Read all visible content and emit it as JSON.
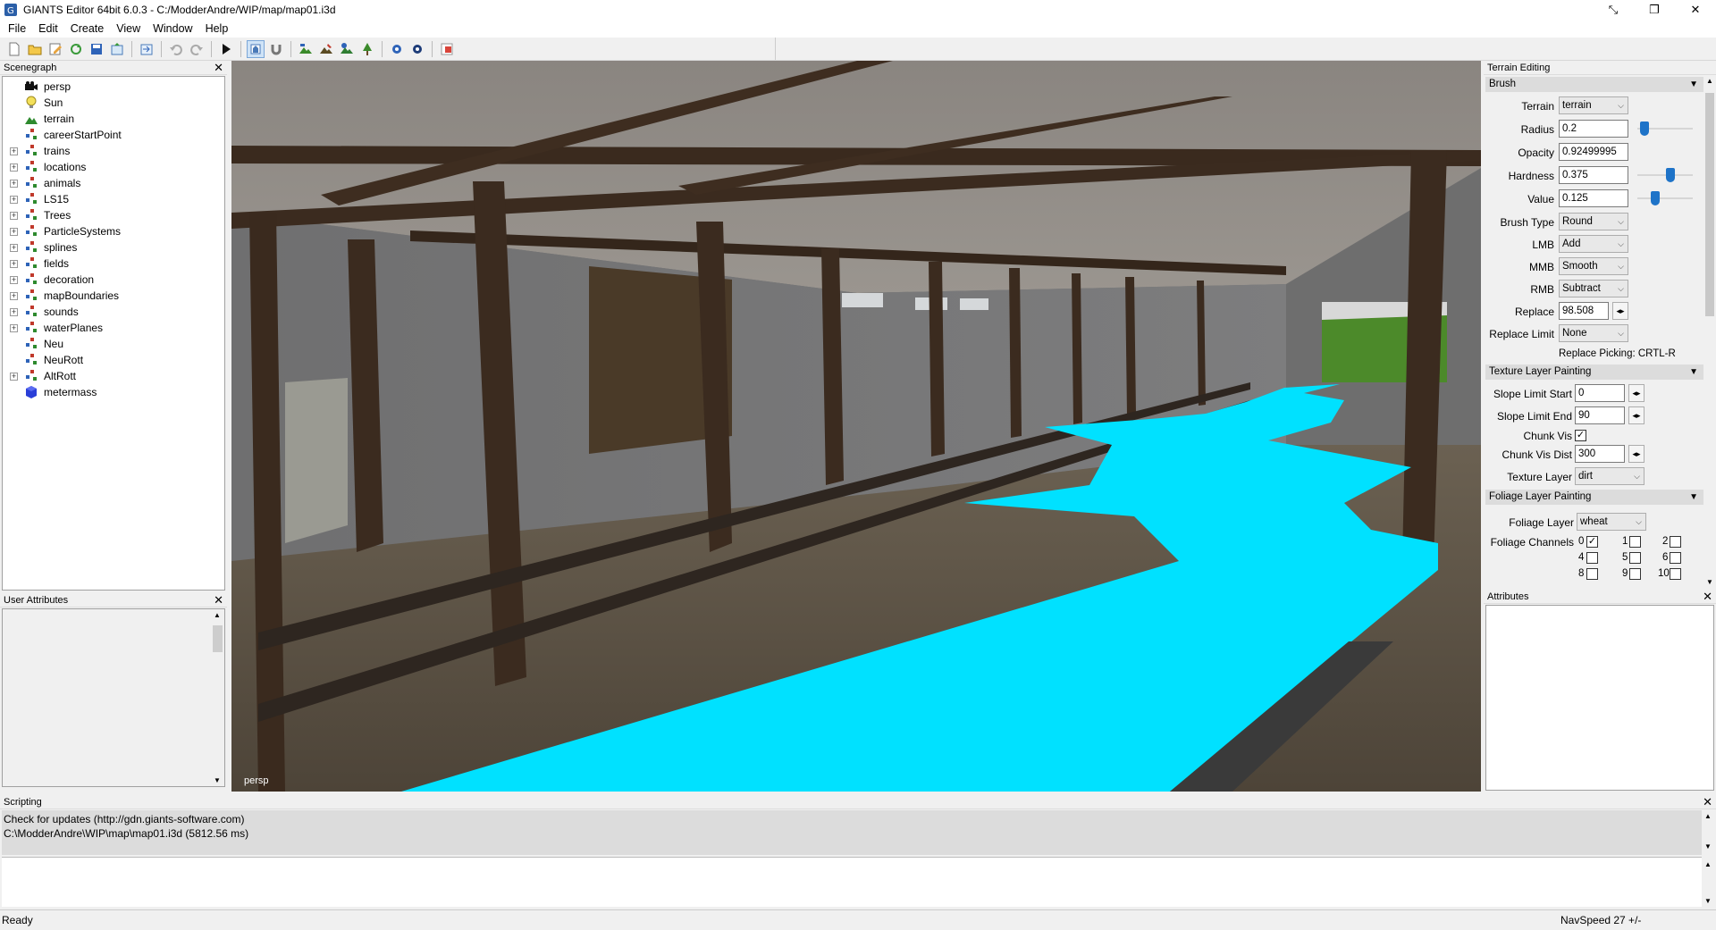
{
  "window": {
    "title": "GIANTS Editor 64bit 6.0.3 - C:/ModderAndre/WIP/map/map01.i3d",
    "restore_glyph": "⤡",
    "maximize_glyph": "❐",
    "close_glyph": "✕"
  },
  "menu": [
    "File",
    "Edit",
    "Create",
    "View",
    "Window",
    "Help"
  ],
  "scenegraph": {
    "title": "Scenegraph",
    "close": "✕",
    "nodes": [
      {
        "label": "persp",
        "icon": "camera-icon",
        "expandable": false
      },
      {
        "label": "Sun",
        "icon": "light-bulb-icon",
        "expandable": false
      },
      {
        "label": "terrain",
        "icon": "terrain-icon",
        "expandable": false
      },
      {
        "label": "careerStartPoint",
        "icon": "transform-group-icon",
        "expandable": false
      },
      {
        "label": "trains",
        "icon": "transform-group-icon",
        "expandable": true
      },
      {
        "label": "locations",
        "icon": "transform-group-icon",
        "expandable": true
      },
      {
        "label": "animals",
        "icon": "transform-group-icon",
        "expandable": true
      },
      {
        "label": "LS15",
        "icon": "transform-group-icon",
        "expandable": true
      },
      {
        "label": "Trees",
        "icon": "transform-group-icon",
        "expandable": true
      },
      {
        "label": "ParticleSystems",
        "icon": "transform-group-icon",
        "expandable": true
      },
      {
        "label": "splines",
        "icon": "transform-group-icon",
        "expandable": true
      },
      {
        "label": "fields",
        "icon": "transform-group-icon",
        "expandable": true
      },
      {
        "label": "decoration",
        "icon": "transform-group-icon",
        "expandable": true
      },
      {
        "label": "mapBoundaries",
        "icon": "transform-group-icon",
        "expandable": true
      },
      {
        "label": "sounds",
        "icon": "transform-group-icon",
        "expandable": true
      },
      {
        "label": "waterPlanes",
        "icon": "transform-group-icon",
        "expandable": true
      },
      {
        "label": "Neu",
        "icon": "transform-group-icon",
        "expandable": false
      },
      {
        "label": "NeuRott",
        "icon": "transform-group-icon",
        "expandable": false
      },
      {
        "label": "AltRott",
        "icon": "transform-group-icon",
        "expandable": true
      },
      {
        "label": "metermass",
        "icon": "shape-cube-icon",
        "expandable": false
      }
    ]
  },
  "user_attributes": {
    "title": "User Attributes",
    "close": "✕"
  },
  "viewport": {
    "label": "persp"
  },
  "terrain_editing": {
    "title": "Terrain Editing",
    "brush": {
      "section": "Brush",
      "terrain_label": "Terrain",
      "terrain_value": "terrain",
      "radius_label": "Radius",
      "radius_value": "0.2",
      "radius_slider": 0.05,
      "opacity_label": "Opacity",
      "opacity_value": "0.92499995",
      "hardness_label": "Hardness",
      "hardness_value": "0.375",
      "hardness_slider": 0.62,
      "value_label": "Value",
      "value_value": "0.125",
      "value_slider": 0.28,
      "brush_type_label": "Brush Type",
      "brush_type_value": "Round",
      "lmb_label": "LMB",
      "lmb_value": "Add",
      "mmb_label": "MMB",
      "mmb_value": "Smooth",
      "rmb_label": "RMB",
      "rmb_value": "Subtract",
      "replace_label": "Replace",
      "replace_value": "98.508",
      "replace_limit_label": "Replace Limit",
      "replace_limit_value": "None",
      "replace_picking": "Replace Picking: CRTL-R"
    },
    "texture": {
      "section": "Texture Layer Painting",
      "slope_start_label": "Slope Limit Start",
      "slope_start_value": "0",
      "slope_end_label": "Slope Limit End",
      "slope_end_value": "90",
      "chunk_vis_label": "Chunk Vis",
      "chunk_vis_checked": "✓",
      "chunk_vis_dist_label": "Chunk Vis Dist",
      "chunk_vis_dist_value": "300",
      "texture_layer_label": "Texture Layer",
      "texture_layer_value": "dirt"
    },
    "foliage": {
      "section": "Foliage Layer Painting",
      "foliage_layer_label": "Foliage Layer",
      "foliage_layer_value": "wheat",
      "foliage_channels_label": "Foliage Channels",
      "channels": [
        "0",
        "1",
        "2",
        "4",
        "5",
        "6",
        "8",
        "9",
        "10"
      ],
      "channel0_checked": "✓"
    }
  },
  "attributes": {
    "title": "Attributes",
    "close": "✕"
  },
  "scripting": {
    "title": "Scripting",
    "close": "✕",
    "lines": [
      "Check for updates (http://gdn.giants-software.com)",
      "C:\\ModderAndre\\WIP\\map\\map01.i3d (5812.56 ms)"
    ]
  },
  "status": {
    "left": "Ready",
    "right": "NavSpeed 27 +/-"
  },
  "colors": {
    "water": "#00e1ff",
    "wood": "#3a2a1e",
    "knob": "#1e73c8"
  }
}
